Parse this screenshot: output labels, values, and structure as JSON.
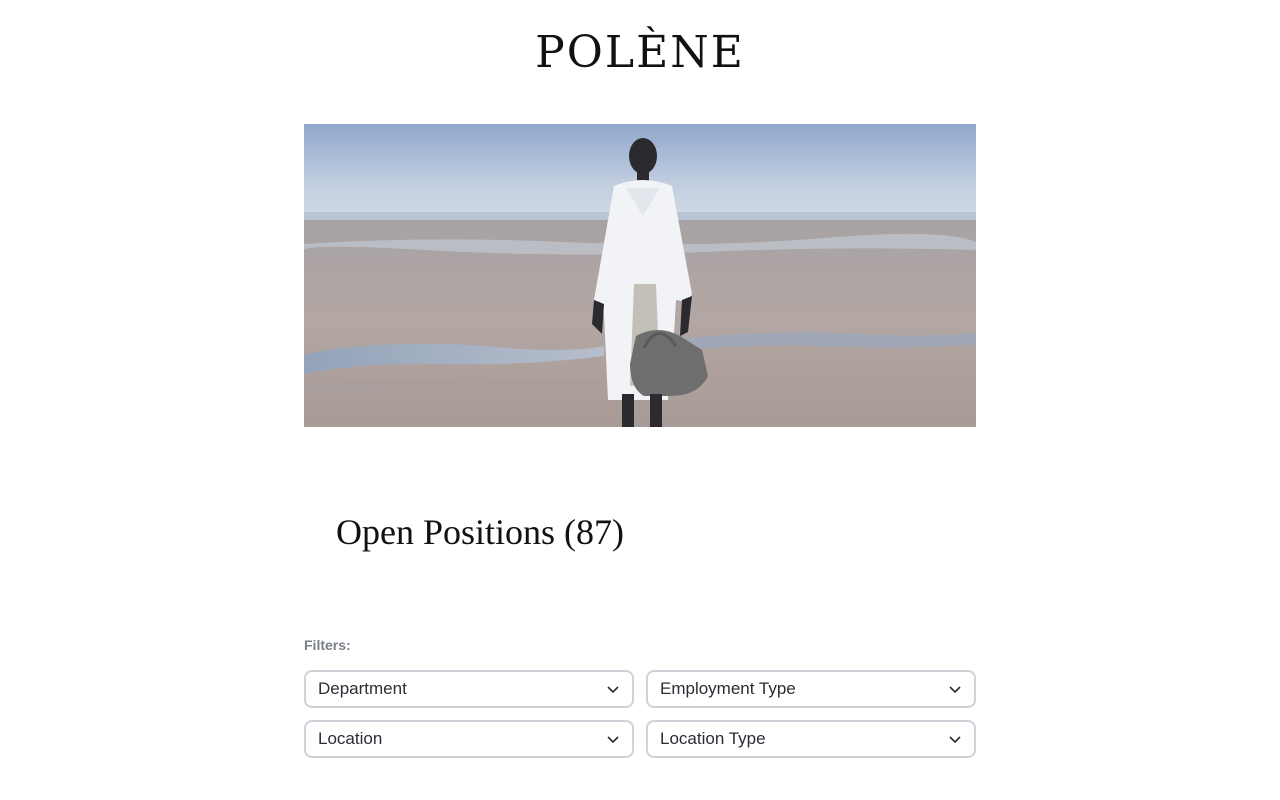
{
  "brand": {
    "logo_text": "POLÈNE"
  },
  "hero": {
    "image": "woman-in-white-coat-on-beach-with-bag"
  },
  "main": {
    "title": "Open Positions (87)",
    "filters_label": "Filters:",
    "filters": [
      {
        "label": "Department",
        "icon": "chevron-down-icon"
      },
      {
        "label": "Employment Type",
        "icon": "chevron-down-icon"
      },
      {
        "label": "Location",
        "icon": "chevron-down-icon"
      },
      {
        "label": "Location Type",
        "icon": "chevron-down-icon"
      }
    ]
  },
  "colors": {
    "text": "#111111",
    "muted_label": "#7a7f8a",
    "select_border": "#cfd2d8",
    "sky": "#a9bcd6",
    "sand": "#a59a96"
  }
}
